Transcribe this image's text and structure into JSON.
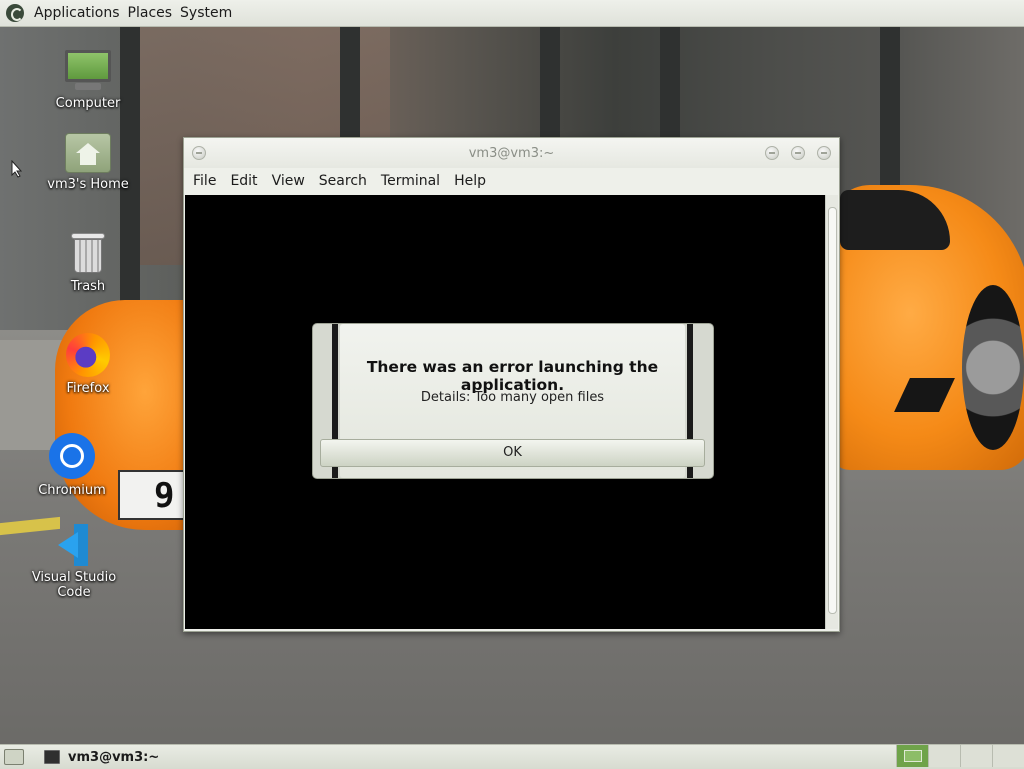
{
  "top_panel": {
    "menus": [
      "Applications",
      "Places",
      "System"
    ],
    "logo_icon": "gnome-foot-icon"
  },
  "desktop": {
    "icons": [
      {
        "label": "Computer",
        "icon": "computer-icon"
      },
      {
        "label": "vm3's Home",
        "icon": "home-folder-icon"
      },
      {
        "label": "Trash",
        "icon": "trash-icon"
      },
      {
        "label": "Firefox",
        "icon": "firefox-icon"
      },
      {
        "label": "Chromium",
        "icon": "chromium-icon"
      },
      {
        "label": "Visual Studio Code",
        "icon": "vscode-icon"
      }
    ]
  },
  "terminal": {
    "title": "vm3@vm3:~",
    "menus": [
      "File",
      "Edit",
      "View",
      "Search",
      "Terminal",
      "Help"
    ]
  },
  "error_dialog": {
    "title": "There was an error launching the application.",
    "detail": "Details: Too many open files",
    "ok_label": "OK"
  },
  "bottom_panel": {
    "task_label": "vm3@vm3:~",
    "workspace_count": 4,
    "active_workspace": 1
  },
  "colors": {
    "panel_bg": "#e3e6dd",
    "terminal_bg": "#000000",
    "workspace_active": "#6fa34a"
  }
}
